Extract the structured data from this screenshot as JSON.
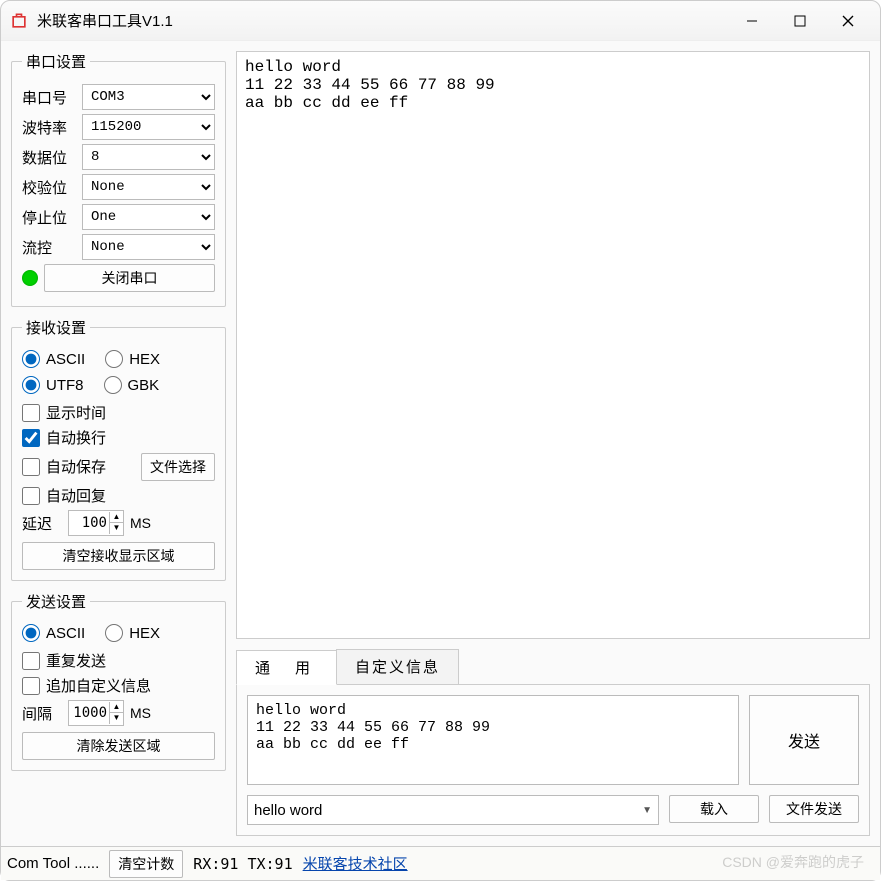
{
  "window": {
    "title": "米联客串口工具V1.1"
  },
  "port": {
    "legend": "串口设置",
    "fields": {
      "port": {
        "label": "串口号",
        "value": "COM3"
      },
      "baud": {
        "label": "波特率",
        "value": "115200"
      },
      "data": {
        "label": "数据位",
        "value": "8"
      },
      "parity": {
        "label": "校验位",
        "value": "None"
      },
      "stop": {
        "label": "停止位",
        "value": "One"
      },
      "flow": {
        "label": "流控",
        "value": "None"
      }
    },
    "close_button": "关闭串口",
    "indicator_color": "#00d000"
  },
  "rx": {
    "legend": "接收设置",
    "mode_ascii": "ASCII",
    "mode_hex": "HEX",
    "enc_utf8": "UTF8",
    "enc_gbk": "GBK",
    "show_time": "显示时间",
    "auto_wrap": "自动换行",
    "auto_save": "自动保存",
    "file_select": "文件选择",
    "auto_reply": "自动回复",
    "delay_label": "延迟",
    "delay_value": "100",
    "delay_unit": "MS",
    "clear_button": "清空接收显示区域"
  },
  "tx": {
    "legend": "发送设置",
    "mode_ascii": "ASCII",
    "mode_hex": "HEX",
    "repeat": "重复发送",
    "append_custom": "追加自定义信息",
    "interval_label": "间隔",
    "interval_value": "1000",
    "interval_unit": "MS",
    "clear_button": "清除发送区域"
  },
  "display": {
    "rx_text": "hello word\n11 22 33 44 55 66 77 88 99\naa bb cc dd ee ff",
    "tabs": {
      "general": "通  用",
      "custom": "自定义信息"
    },
    "tx_text": "hello word\n11 22 33 44 55 66 77 88 99\naa bb cc dd ee ff",
    "send_button": "发送",
    "load_combo_value": "hello word",
    "load_button": "载入",
    "file_send_button": "文件发送"
  },
  "status": {
    "tool": "Com Tool ......",
    "clear_count": "清空计数",
    "counts": "RX:91 TX:91",
    "link": "米联客技术社区"
  },
  "watermark": "CSDN @爱奔跑的虎子"
}
